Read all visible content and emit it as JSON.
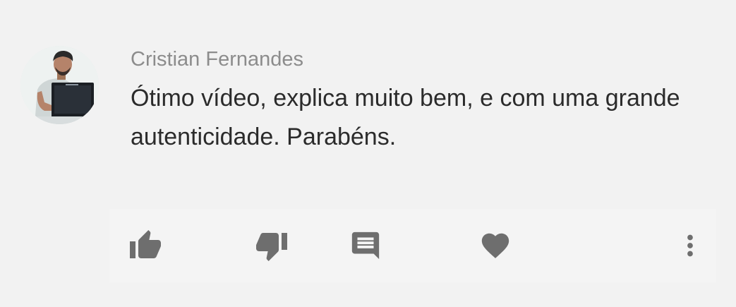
{
  "comment": {
    "author": "Cristian Fernandes",
    "text": "Ótimo vídeo, explica muito bem, e com uma grande autenticidade. Parabéns.",
    "avatar": "user-avatar-photo"
  },
  "actions": [
    {
      "icon": "thumb-up-icon"
    },
    {
      "icon": "thumb-down-icon"
    },
    {
      "icon": "reply-comment-icon"
    },
    {
      "icon": "heart-icon"
    },
    {
      "icon": "more-vertical-icon"
    }
  ],
  "colors": {
    "background": "#f2f2f2",
    "author": "#8c8c8c",
    "text": "#2b2b2b",
    "icon": "#6e6e6e"
  }
}
